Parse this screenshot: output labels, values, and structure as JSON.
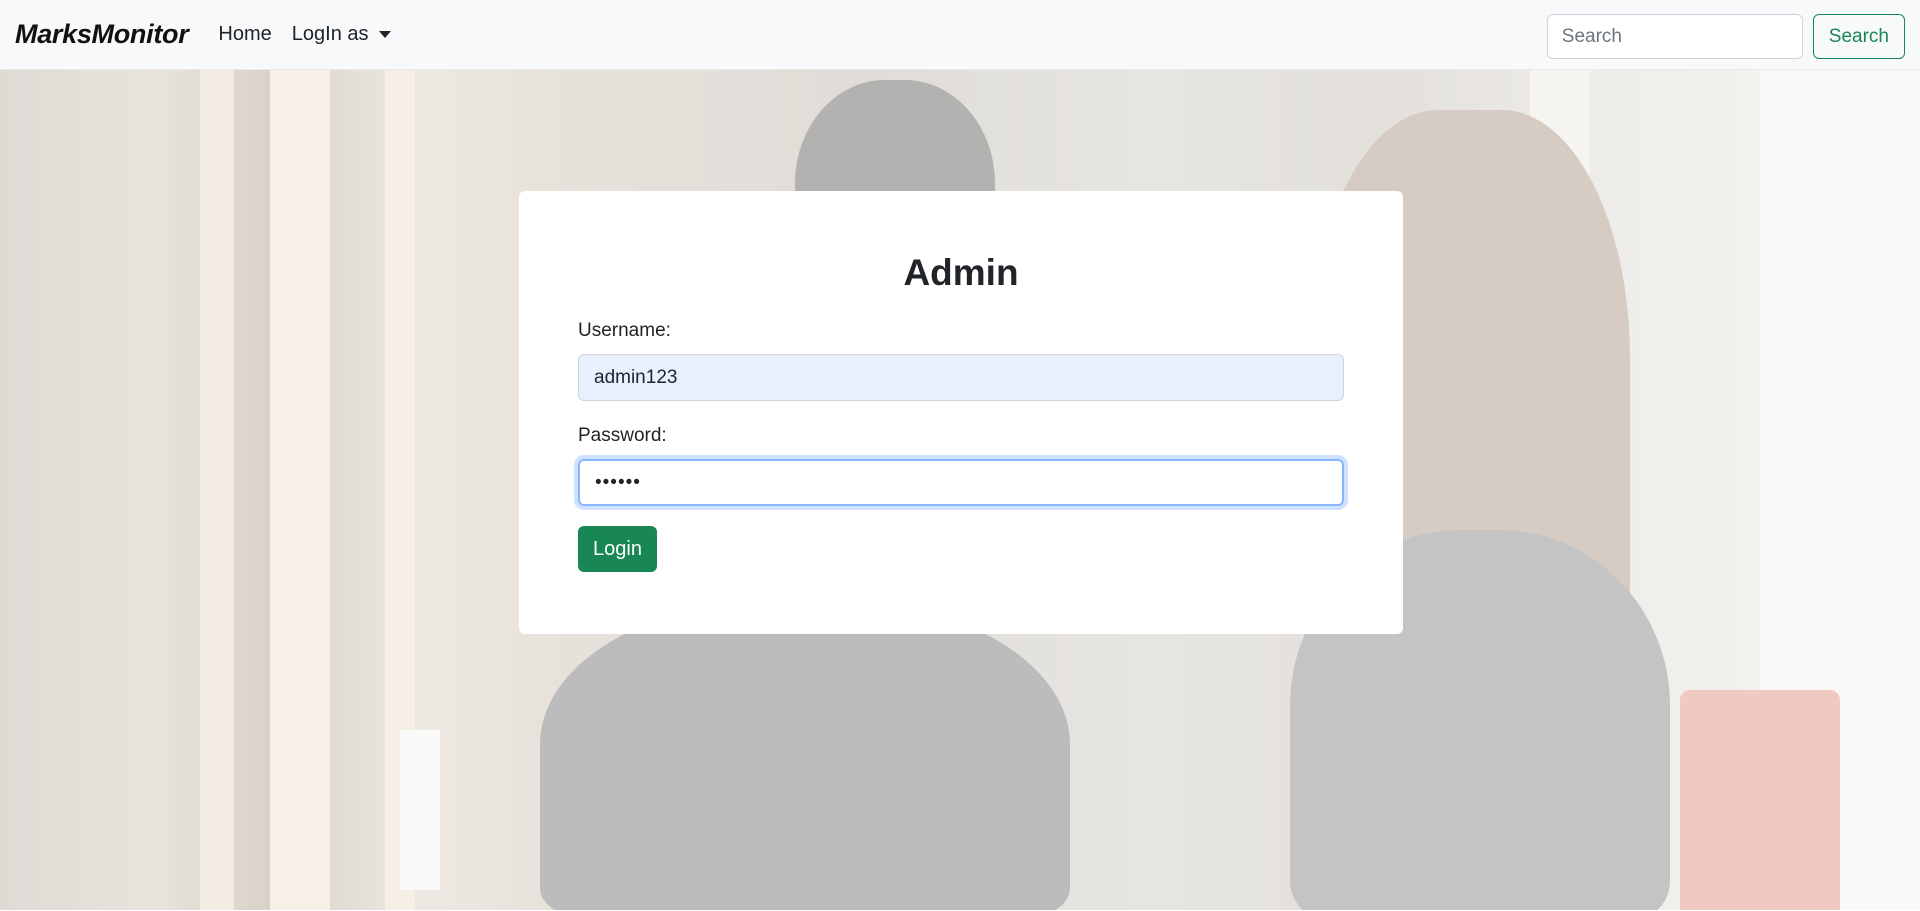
{
  "navbar": {
    "brand": "MarksMonitor",
    "home_label": "Home",
    "login_as_label": "LogIn as",
    "search_placeholder": "Search",
    "search_button_label": "Search"
  },
  "login_form": {
    "title": "Admin",
    "username_label": "Username:",
    "username_value": "admin123",
    "password_label": "Password:",
    "password_value": "••••••",
    "login_button_label": "Login"
  },
  "colors": {
    "accent": "#198754",
    "navbar_bg": "#f8f9fa",
    "autofill_bg": "#e8f0fe",
    "focus_border": "#86b7fe"
  }
}
